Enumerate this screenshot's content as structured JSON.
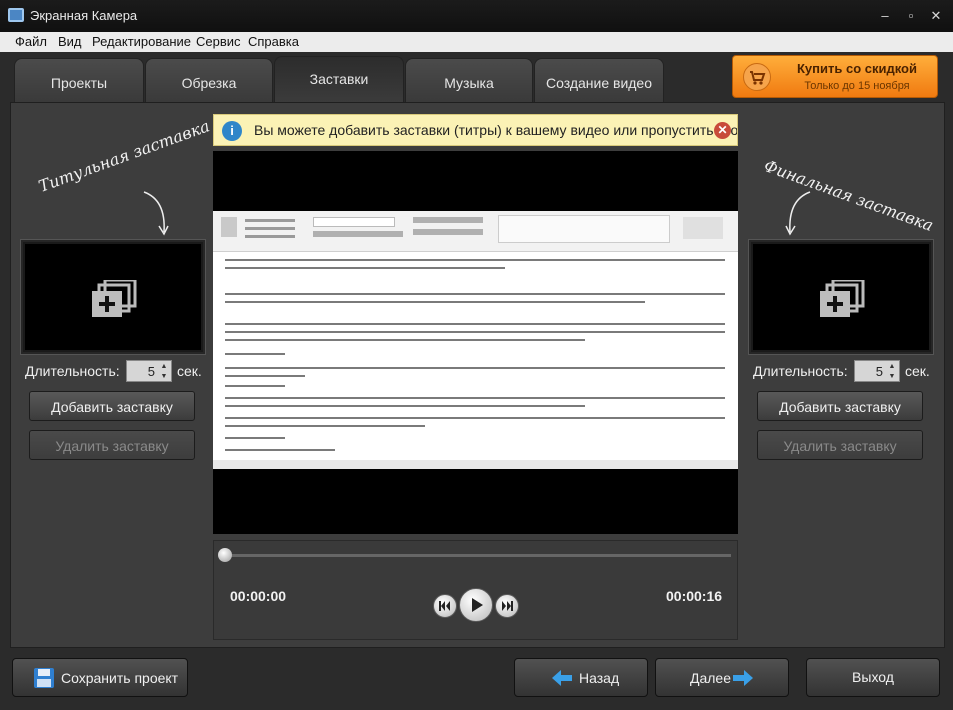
{
  "window": {
    "title": "Экранная Камера",
    "min": "–",
    "max": "▫",
    "close": "✕"
  },
  "menu": [
    "Файл",
    "Вид",
    "Редактирование",
    "Сервис",
    "Справка"
  ],
  "tabs": [
    "Проекты",
    "Обрезка",
    "Заставки",
    "Музыка",
    "Создание видео"
  ],
  "active_tab": "Заставки",
  "promo": {
    "label": "Купить со скидкой",
    "sub": "Только до 15 ноября"
  },
  "info": {
    "icon": "i",
    "text": "Вы можете добавить заставки (титры) к вашему видео или пропустить этот ш",
    "close": "✕"
  },
  "left": {
    "title": "Титульная заставка",
    "duration_label": "Длительность:",
    "duration": "5",
    "seconds": "сек.",
    "add": "Добавить заставку",
    "remove": "Удалить заставку"
  },
  "right": {
    "title": "Финальная заставка",
    "duration_label": "Длительность:",
    "duration": "5",
    "seconds": "сек.",
    "add": "Добавить заставку",
    "remove": "Удалить заставку"
  },
  "player": {
    "current": "00:00:00",
    "total": "00:00:16",
    "progress": 0
  },
  "bottom": {
    "save": "Сохранить проект",
    "back": "Назад",
    "next": "Далее",
    "exit": "Выход"
  },
  "colors": {
    "accent": "#f28a1e",
    "info_bg": "#fbf2b5",
    "bg": "#2b2b2b"
  },
  "icons": [
    "app-icon",
    "cart-icon",
    "info-icon",
    "close-icon",
    "add-media-icon",
    "save-disk-icon",
    "arrow-left-icon",
    "arrow-right-icon",
    "rewind-icon",
    "play-icon",
    "forward-icon"
  ]
}
